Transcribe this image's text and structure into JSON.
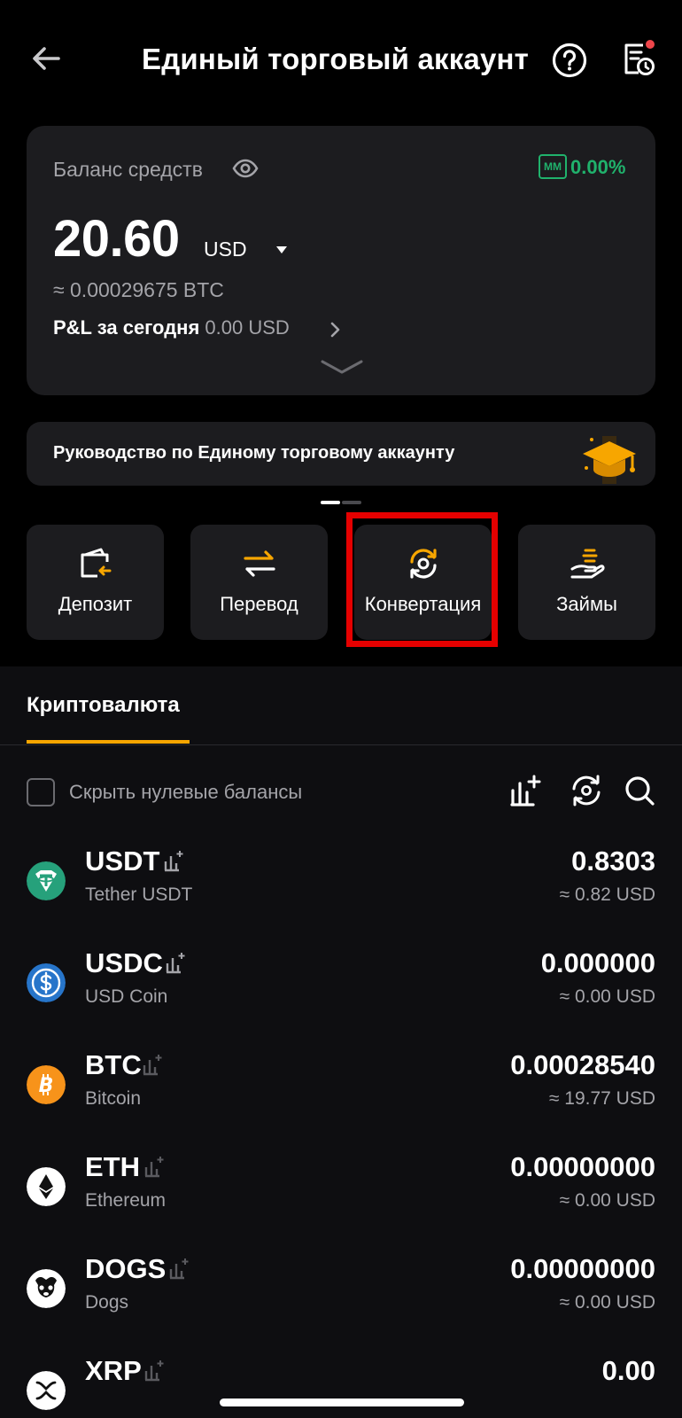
{
  "header": {
    "title": "Единый торговый аккаунт",
    "has_notification_dot": true
  },
  "balance": {
    "label": "Баланс средств",
    "mm_badge": "MM",
    "mm_value": "0.00%",
    "amount": "20.60",
    "currency": "USD",
    "btc_equiv": "≈ 0.00029675 BTC",
    "pnl_label": "P&L за сегодня",
    "pnl_value": "0.00 USD"
  },
  "guide": {
    "text": "Руководство по Единому торговому аккаунту"
  },
  "actions": [
    {
      "label": "Депозит",
      "icon": "wallet-deposit-icon"
    },
    {
      "label": "Перевод",
      "icon": "transfer-arrows-icon"
    },
    {
      "label": "Конвертация",
      "icon": "convert-icon",
      "highlighted": true
    },
    {
      "label": "Займы",
      "icon": "loan-hand-icon"
    }
  ],
  "assets_panel": {
    "tab": "Криптовалюта",
    "hide_zero_label": "Скрыть нулевые балансы",
    "hide_zero_checked": false
  },
  "assets": [
    {
      "symbol": "USDT",
      "name": "Tether USDT",
      "amount": "0.8303",
      "usd": "≈ 0.82 USD",
      "color": "#26a17b"
    },
    {
      "symbol": "USDC",
      "name": "USD Coin",
      "amount": "0.000000",
      "usd": "≈ 0.00 USD",
      "color": "#2775ca"
    },
    {
      "symbol": "BTC",
      "name": "Bitcoin",
      "amount": "0.00028540",
      "usd": "≈ 19.77 USD",
      "color": "#f7931a"
    },
    {
      "symbol": "ETH",
      "name": "Ethereum",
      "amount": "0.00000000",
      "usd": "≈ 0.00 USD",
      "color": "#ffffff"
    },
    {
      "symbol": "DOGS",
      "name": "Dogs",
      "amount": "0.00000000",
      "usd": "≈ 0.00 USD",
      "color": "#ffffff"
    },
    {
      "symbol": "XRP",
      "name": "",
      "amount": "0.00",
      "usd": "",
      "color": "#ffffff"
    }
  ],
  "colors": {
    "accent": "#f7a600",
    "positive": "#20b26c",
    "highlight_box": "#e50000"
  }
}
